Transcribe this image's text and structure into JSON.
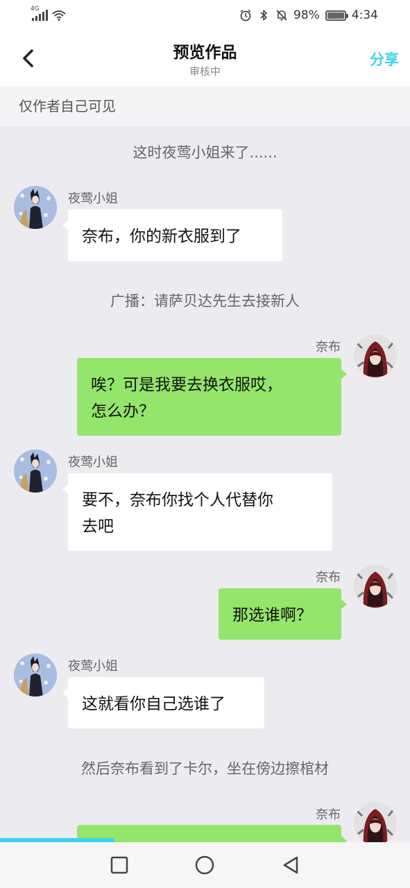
{
  "status_bar": {
    "network": "4G",
    "battery_percent": "98%",
    "battery_level": 0.98,
    "time": "4:34",
    "icons": [
      "signal-icon",
      "wifi-icon",
      "alarm-icon",
      "bluetooth-icon",
      "mute-icon",
      "battery-icon"
    ]
  },
  "nav": {
    "title": "预览作品",
    "subtitle": "审核中",
    "share_label": "分享",
    "accent_color": "#3fd3e8"
  },
  "notice": "仅作者自己可见",
  "characters": {
    "left": "夜莺小姐",
    "right": "奈布"
  },
  "messages": [
    {
      "type": "narration",
      "text": "这时夜莺小姐来了......"
    },
    {
      "type": "left",
      "name": "夜莺小姐",
      "text": "奈布，你的新衣服到了"
    },
    {
      "type": "narration",
      "text": "广播：请萨贝达先生去接新人"
    },
    {
      "type": "right",
      "name": "奈布",
      "line1": "唉？可是我要去换衣服哎，",
      "line2": "怎么办？"
    },
    {
      "type": "left",
      "name": "夜莺小姐",
      "line1": "要不，奈布你找个人代替你",
      "line2": "去吧"
    },
    {
      "type": "right",
      "name": "奈布",
      "text": "那选谁啊？"
    },
    {
      "type": "left",
      "name": "夜莺小姐",
      "text": "这就看你自己选谁了"
    },
    {
      "type": "narration",
      "text": "然后奈布看到了卡尔，坐在傍边擦棺材"
    },
    {
      "type": "right",
      "name": "奈布",
      "text": ""
    }
  ],
  "reading_progress": 0.28,
  "bubble_colors": {
    "left": "#ffffff",
    "right": "#94e56b"
  }
}
